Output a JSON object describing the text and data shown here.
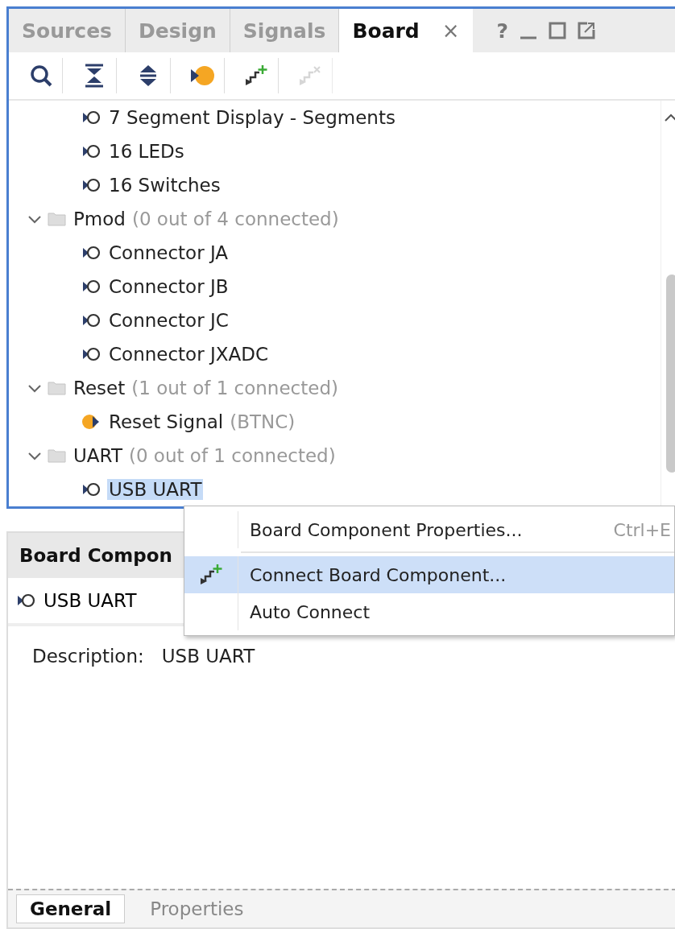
{
  "tabs": [
    {
      "label": "Sources",
      "selected": false
    },
    {
      "label": "Design",
      "selected": false
    },
    {
      "label": "Signals",
      "selected": false
    },
    {
      "label": "Board",
      "selected": true,
      "close": "×"
    }
  ],
  "window_controls": [
    "?"
  ],
  "toolbar": [
    {
      "kind": "search",
      "disabled": false
    },
    {
      "kind": "collapse",
      "disabled": false
    },
    {
      "kind": "expand",
      "disabled": false
    },
    {
      "kind": "auto",
      "disabled": false
    },
    {
      "kind": "connect",
      "disabled": false
    },
    {
      "kind": "disconnect",
      "disabled": true
    }
  ],
  "tree": [
    {
      "children": [
        {
          "label": "7 Segment Display - Segments",
          "connected": false,
          "selected": false
        },
        {
          "label": "16 LEDs",
          "connected": false,
          "selected": false
        },
        {
          "label": "16 Switches",
          "connected": false,
          "selected": false
        }
      ]
    },
    {
      "label": "Pmod",
      "status": "(0 out of 4 connected)",
      "expanded": true,
      "children": [
        {
          "label": "Connector JA",
          "connected": false,
          "selected": false
        },
        {
          "label": "Connector JB",
          "connected": false,
          "selected": false
        },
        {
          "label": "Connector JC",
          "connected": false,
          "selected": false
        },
        {
          "label": "Connector JXADC",
          "connected": false,
          "selected": false
        }
      ]
    },
    {
      "label": "Reset",
      "status": "(1 out of 1 connected)",
      "expanded": true,
      "children": [
        {
          "label": "Reset Signal",
          "note": "(BTNC)",
          "connected": true,
          "selected": false
        }
      ]
    },
    {
      "label": "UART",
      "status": "(0 out of 1 connected)",
      "expanded": true,
      "children": [
        {
          "label": "USB UART",
          "connected": false,
          "selected": true
        }
      ]
    }
  ],
  "context_menu": [
    {
      "kind": "item",
      "label": "Board Component Properties...",
      "shortcut": "Ctrl+E",
      "icon": false,
      "highlighted": false
    },
    {
      "kind": "separator"
    },
    {
      "kind": "item",
      "label": "Connect Board Component...",
      "icon": true,
      "highlighted": true
    },
    {
      "kind": "item",
      "label": "Auto Connect",
      "icon": false,
      "highlighted": false
    }
  ],
  "properties": {
    "title": "Board Compon",
    "item": "USB UART",
    "description_label": "Description:",
    "description": "USB UART",
    "tabs": [
      {
        "label": "General",
        "selected": true
      },
      {
        "label": "Properties",
        "selected": false
      }
    ]
  }
}
